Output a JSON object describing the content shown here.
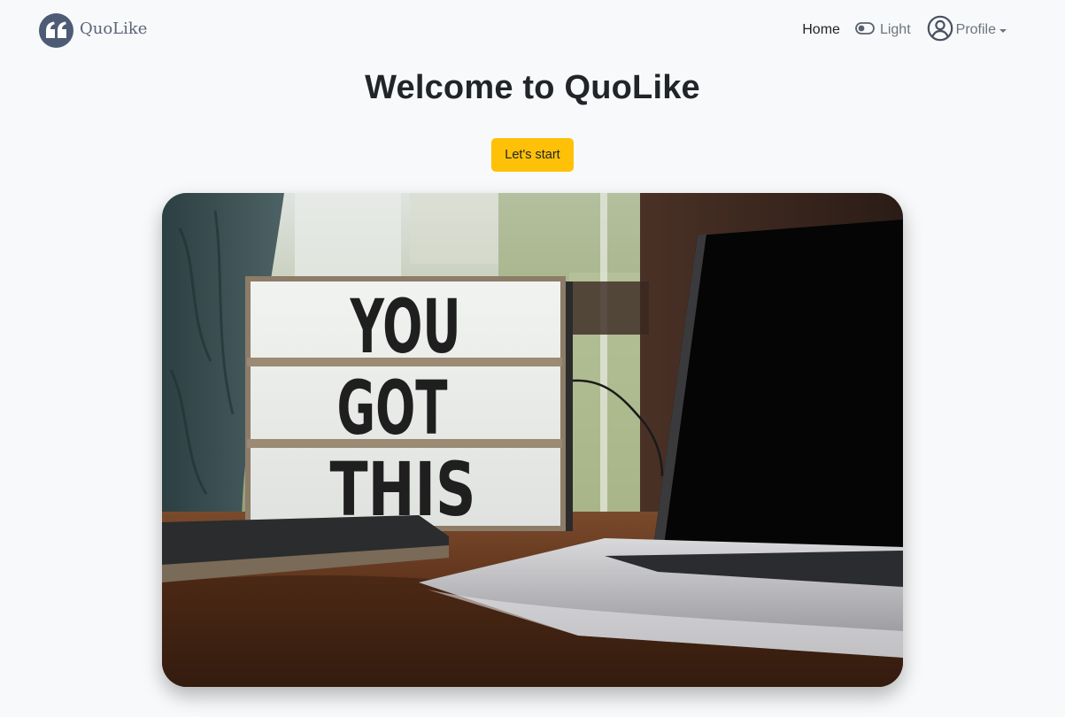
{
  "brand": {
    "name": "QuoLike",
    "logo_icon": "quote-icon",
    "logo_color": "#4e5b75"
  },
  "nav": {
    "home_label": "Home",
    "theme_label": "Light",
    "theme_icon": "toggle-icon",
    "profile_label": "Profile",
    "profile_icon": "user-circle-icon"
  },
  "hero": {
    "title": "Welcome to QuoLike",
    "button_label": "Let's start",
    "button_color": "#ffc107",
    "image_text": [
      "YOU",
      "GOT",
      "THIS"
    ]
  }
}
